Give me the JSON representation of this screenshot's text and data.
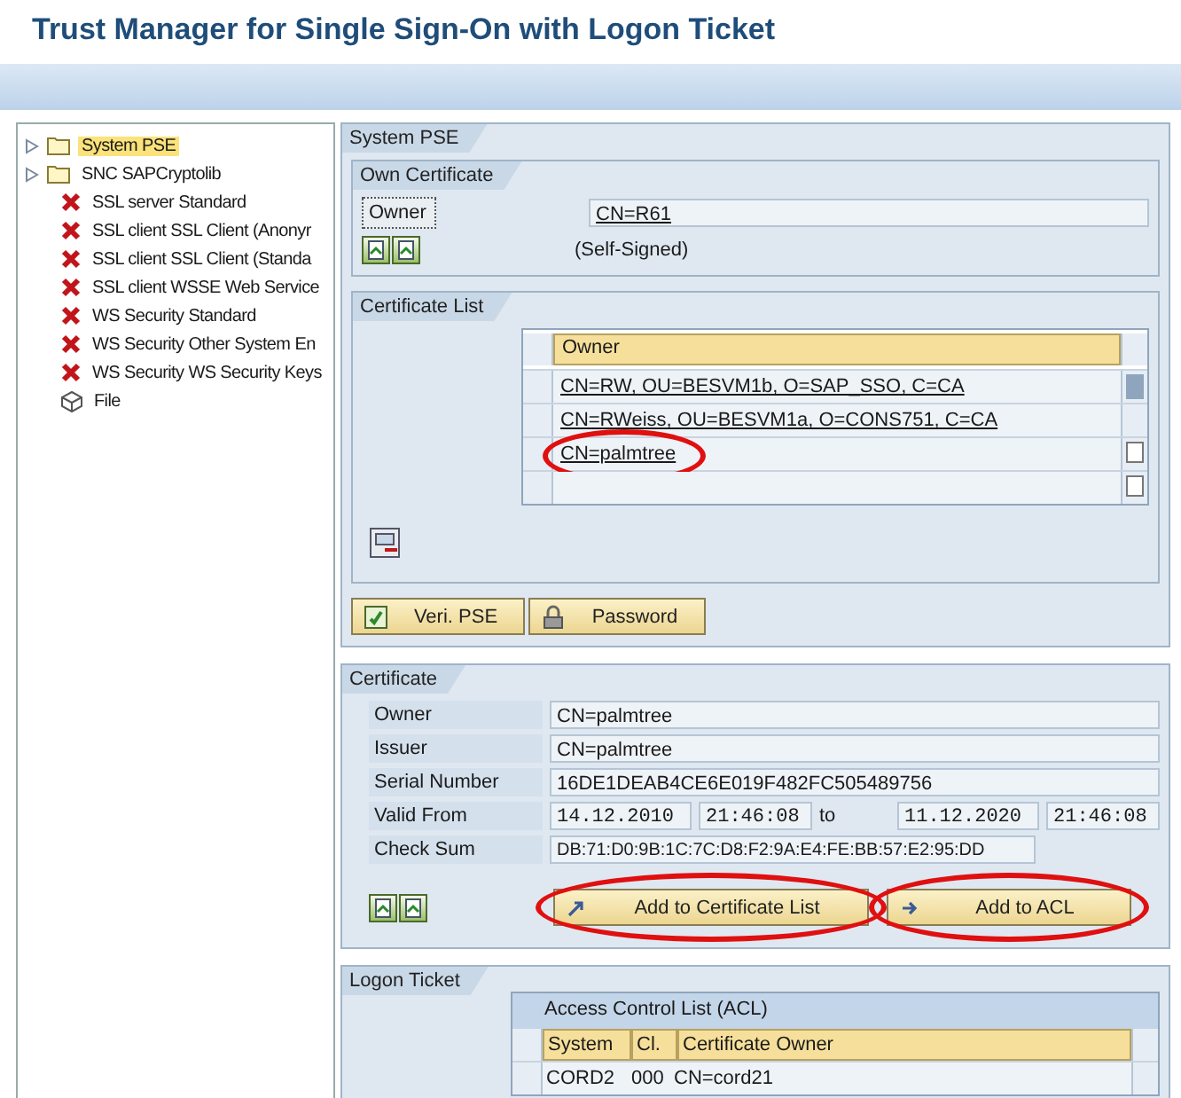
{
  "title": "Trust Manager for Single Sign-On with Logon Ticket",
  "tree": [
    {
      "label": "System PSE",
      "kind": "folder",
      "selected": true
    },
    {
      "label": "SNC SAPCryptolib",
      "kind": "folder",
      "selected": false
    },
    {
      "label": "SSL server Standard",
      "kind": "error",
      "selected": false
    },
    {
      "label": "SSL client SSL Client (Anonyr",
      "kind": "error",
      "selected": false
    },
    {
      "label": "SSL client SSL Client (Standa",
      "kind": "error",
      "selected": false
    },
    {
      "label": "SSL client WSSE Web Service",
      "kind": "error",
      "selected": false
    },
    {
      "label": "WS Security Standard",
      "kind": "error",
      "selected": false
    },
    {
      "label": "WS Security Other System En",
      "kind": "error",
      "selected": false
    },
    {
      "label": "WS Security WS Security Keys",
      "kind": "error",
      "selected": false
    },
    {
      "label": "File",
      "kind": "file",
      "selected": false
    }
  ],
  "system_pse": {
    "title": "System PSE",
    "own_certificate": {
      "title": "Own Certificate",
      "owner_label": "Owner",
      "owner": "CN=R61",
      "status": "(Self-Signed)"
    },
    "certificate_list": {
      "title": "Certificate List",
      "column": "Owner",
      "rows": [
        {
          "owner": "CN=RW, OU=BESVM1b, O=SAP_SSO, C=CA",
          "circled": false
        },
        {
          "owner": "CN=RWeiss, OU=BESVM1a, O=CONS751, C=CA",
          "circled": false
        },
        {
          "owner": "CN=palmtree",
          "circled": true
        }
      ]
    },
    "buttons": [
      {
        "label": "Veri. PSE",
        "kind": "verify"
      },
      {
        "label": "Password",
        "kind": "lock"
      }
    ]
  },
  "certificate": {
    "title": "Certificate",
    "fields": [
      {
        "label": "Owner",
        "value": "CN=palmtree"
      },
      {
        "label": "Issuer",
        "value": "CN=palmtree"
      },
      {
        "label": "Serial Number",
        "value": "16DE1DEAB4CE6E019F482FC505489756"
      }
    ],
    "valid": {
      "label": "Valid From",
      "date_from": "14.12.2010",
      "time_from": "21:46:08",
      "to": "to",
      "date_to": "11.12.2020",
      "time_to": "21:46:08"
    },
    "check_sum": {
      "label": "Check Sum",
      "value": "DB:71:D0:9B:1C:7C:D8:F2:9A:E4:FE:BB:57:E2:95:DD"
    },
    "buttons": [
      {
        "label": "Add to Certificate List",
        "kind": "add-list",
        "circled": true
      },
      {
        "label": "Add to ACL",
        "kind": "add-acl",
        "circled": true
      }
    ]
  },
  "logon_ticket": {
    "title": "Logon Ticket",
    "acl": {
      "title": "Access Control List (ACL)",
      "columns": [
        "System",
        "Cl.",
        "Certificate Owner"
      ],
      "rows": [
        [
          "CORD2",
          "000",
          "CN=cord21"
        ]
      ]
    }
  }
}
